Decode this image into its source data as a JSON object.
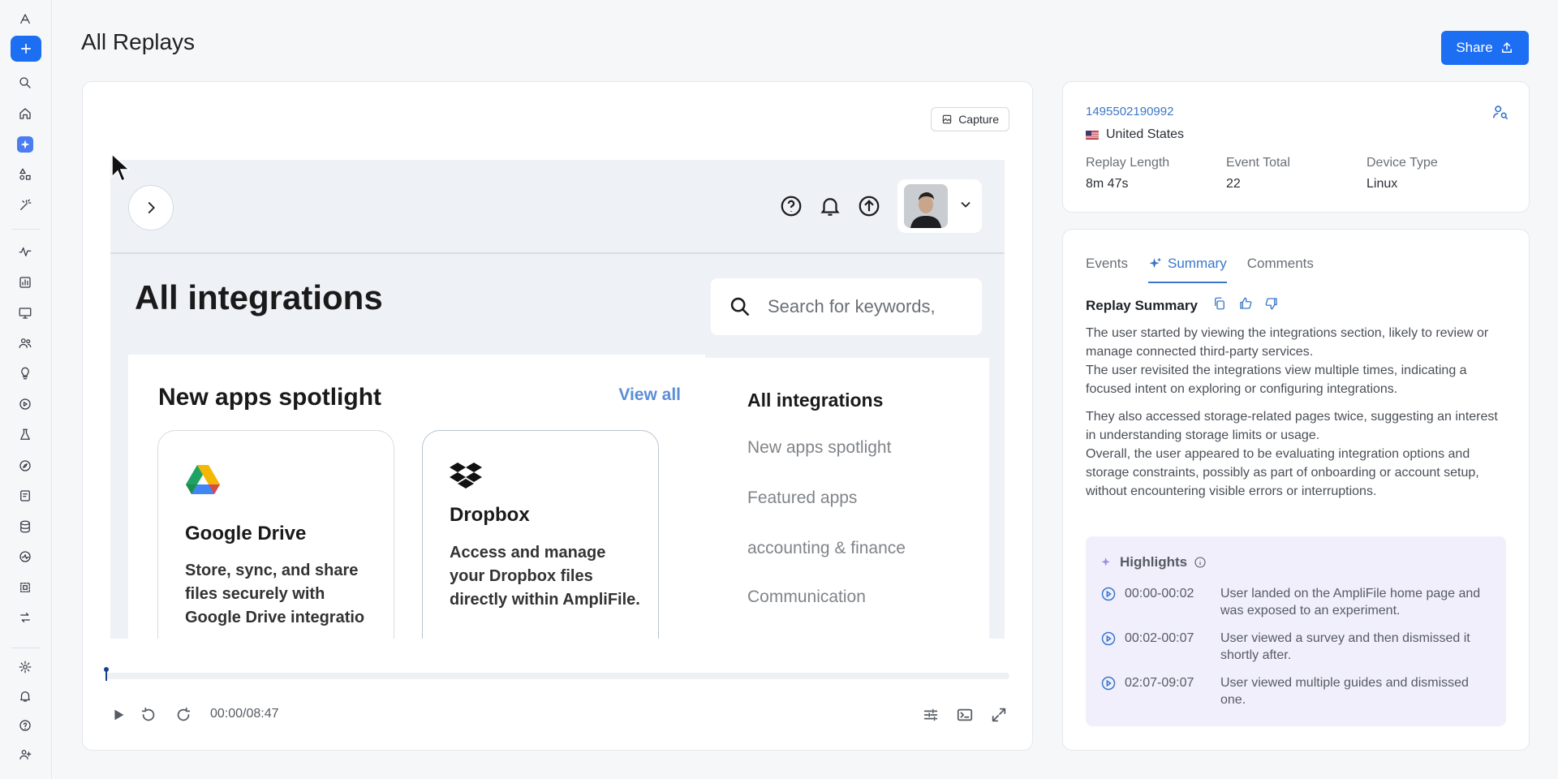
{
  "header": {
    "title": "All Replays",
    "share_label": "Share"
  },
  "rail": {
    "items": [
      "logo",
      "add",
      "search",
      "home",
      "ai-assistant",
      "shapes",
      "magic",
      "activity",
      "charts",
      "monitor",
      "users",
      "lightbulb",
      "replay",
      "flask",
      "compass",
      "feature",
      "database",
      "metrics",
      "segment",
      "sync",
      "settings",
      "notifications",
      "help",
      "invite-user"
    ]
  },
  "player": {
    "capture_label": "Capture",
    "time": "00:00/08:47",
    "progress": 0.0
  },
  "replay_page": {
    "heading": "All integrations",
    "search_placeholder": "Search for keywords,",
    "spotlight_title": "New apps spotlight",
    "view_all": "View all",
    "apps": [
      {
        "name": "Google Drive",
        "desc": "Store, sync, and share files securely with Google Drive integratio"
      },
      {
        "name": "Dropbox",
        "desc": "Access and manage your Dropbox files  directly within AmpliFile."
      }
    ],
    "nav": [
      "All integrations",
      "New apps spotlight",
      "Featured apps",
      "accounting & finance",
      "Communication"
    ]
  },
  "info": {
    "user_id": "1495502190992",
    "country": "United States",
    "stats": [
      {
        "label": "Replay Length",
        "value": "8m 47s"
      },
      {
        "label": "Event Total",
        "value": "22"
      },
      {
        "label": "Device Type",
        "value": "Linux"
      }
    ]
  },
  "summary": {
    "tabs": [
      "Events",
      "Summary",
      "Comments"
    ],
    "active_tab": "Summary",
    "title": "Replay Summary",
    "paragraphs": [
      "The user started by viewing the integrations section, likely to review or manage connected third-party services.\nThe user revisited the integrations view multiple times, indicating a focused intent on exploring or configuring integrations.",
      "They also accessed storage-related pages twice, suggesting an interest in understanding storage limits or usage.\nOverall, the user appeared to be evaluating integration options and storage constraints, possibly as part of onboarding or account setup, without encountering visible errors or interruptions."
    ],
    "highlights_title": "Highlights",
    "highlights": [
      {
        "time": "00:00-00:02",
        "text": "User landed on the AmpliFile home page and was exposed to an experiment."
      },
      {
        "time": "00:02-00:07",
        "text": "User viewed a survey and then dismissed it shortly after."
      },
      {
        "time": "02:07-09:07",
        "text": "User viewed multiple guides and dismissed one."
      }
    ]
  },
  "colors": {
    "accent": "#1c6ef2",
    "link": "#3a77c9",
    "highlight_bg": "#f1effb"
  }
}
